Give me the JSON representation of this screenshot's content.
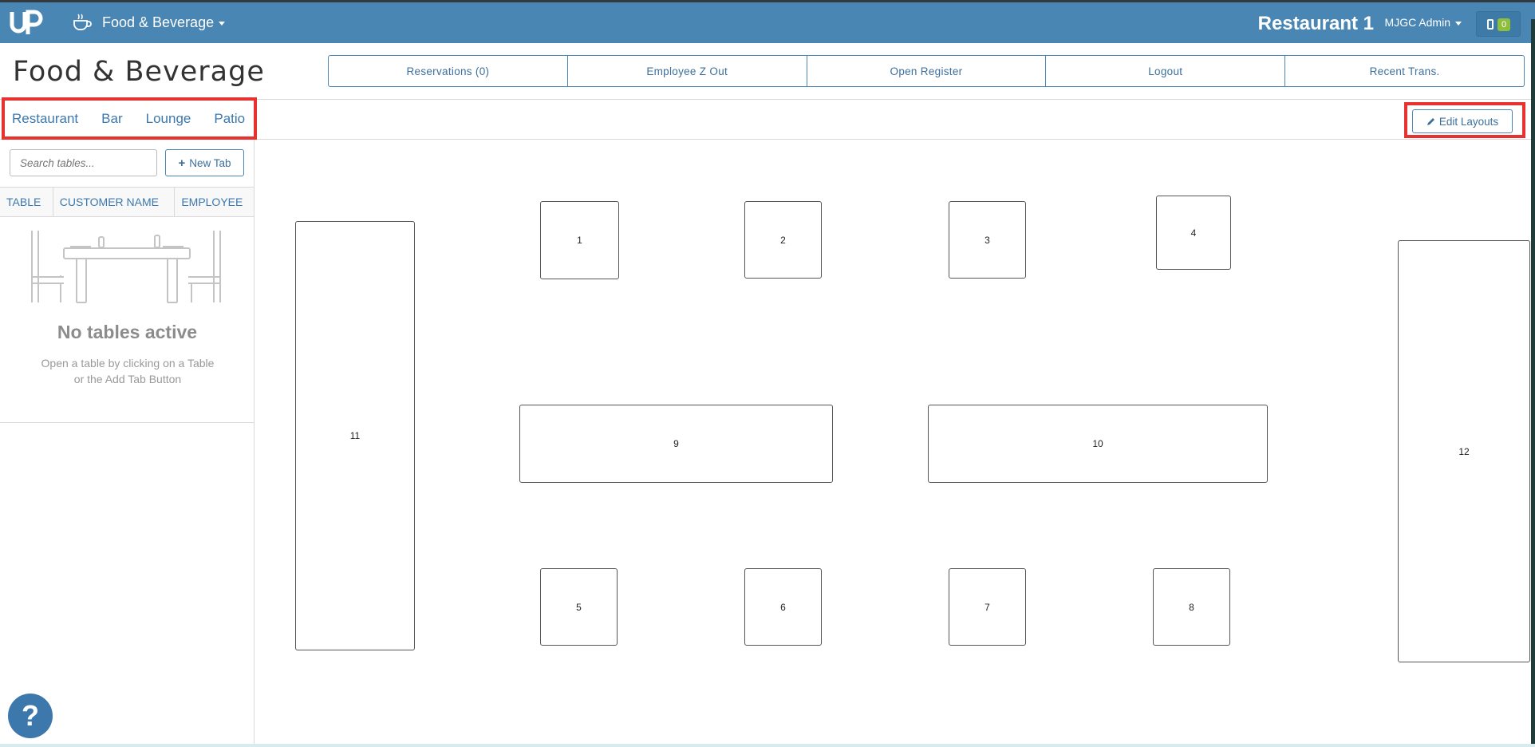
{
  "topbar": {
    "module_title": "Food & Beverage",
    "venue": "Restaurant 1",
    "user": "MJGC Admin",
    "device_count": "0"
  },
  "header": {
    "page_title": "Food & Beverage",
    "actions": [
      "Reservations (0)",
      "Employee Z Out",
      "Open Register",
      "Logout",
      "Recent Trans."
    ]
  },
  "areas": {
    "tabs": [
      "Restaurant",
      "Bar",
      "Lounge",
      "Patio"
    ],
    "edit_layouts": "Edit Layouts"
  },
  "sidebar": {
    "search_placeholder": "Search tables...",
    "new_tab": "New Tab",
    "columns": [
      "TABLE",
      "CUSTOMER NAME",
      "EMPLOYEE"
    ],
    "empty_title": "No tables active",
    "empty_line1": "Open a table by clicking on a Table",
    "empty_line2": "or the Add Tab Button"
  },
  "help": "?",
  "floor": {
    "tables": [
      "1",
      "2",
      "3",
      "4",
      "5",
      "6",
      "7",
      "8",
      "9",
      "10",
      "11",
      "12"
    ]
  }
}
